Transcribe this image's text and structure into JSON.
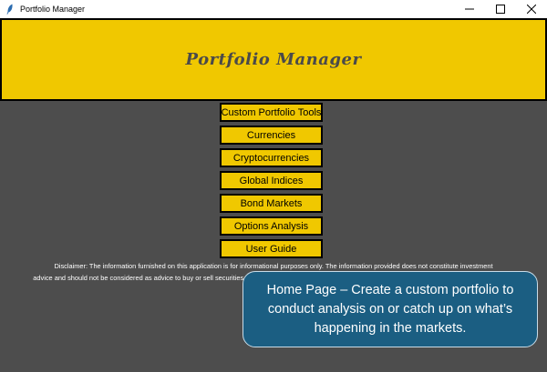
{
  "window": {
    "title": "Portfolio Manager",
    "app_icon": "feather-icon",
    "controls": [
      "minimize-icon",
      "maximize-icon",
      "close-icon"
    ]
  },
  "banner": {
    "title": "Portfolio Manager",
    "background": "#f0c800"
  },
  "menu": {
    "items": [
      {
        "label": "Custom Portfolio Tools"
      },
      {
        "label": "Currencies"
      },
      {
        "label": "Cryptocurrencies"
      },
      {
        "label": "Global Indices"
      },
      {
        "label": "Bond Markets"
      },
      {
        "label": "Options Analysis"
      },
      {
        "label": "User Guide"
      }
    ]
  },
  "disclaimer": {
    "line1": "Disclaimer: The information furnished on this application is for informational purposes only. The information provided does not constitute investment",
    "line2": "advice and should not be considered as advice to buy or sell securities. The information should not be relied upon by any person to make an investment decision."
  },
  "callout": {
    "text": "Home Page – Create a custom portfolio to conduct analysis on or catch up on what’s happening in the markets."
  },
  "colors": {
    "content_background": "#4d4d4d",
    "button_background": "#f0c800",
    "callout_background": "#1b5e82"
  }
}
